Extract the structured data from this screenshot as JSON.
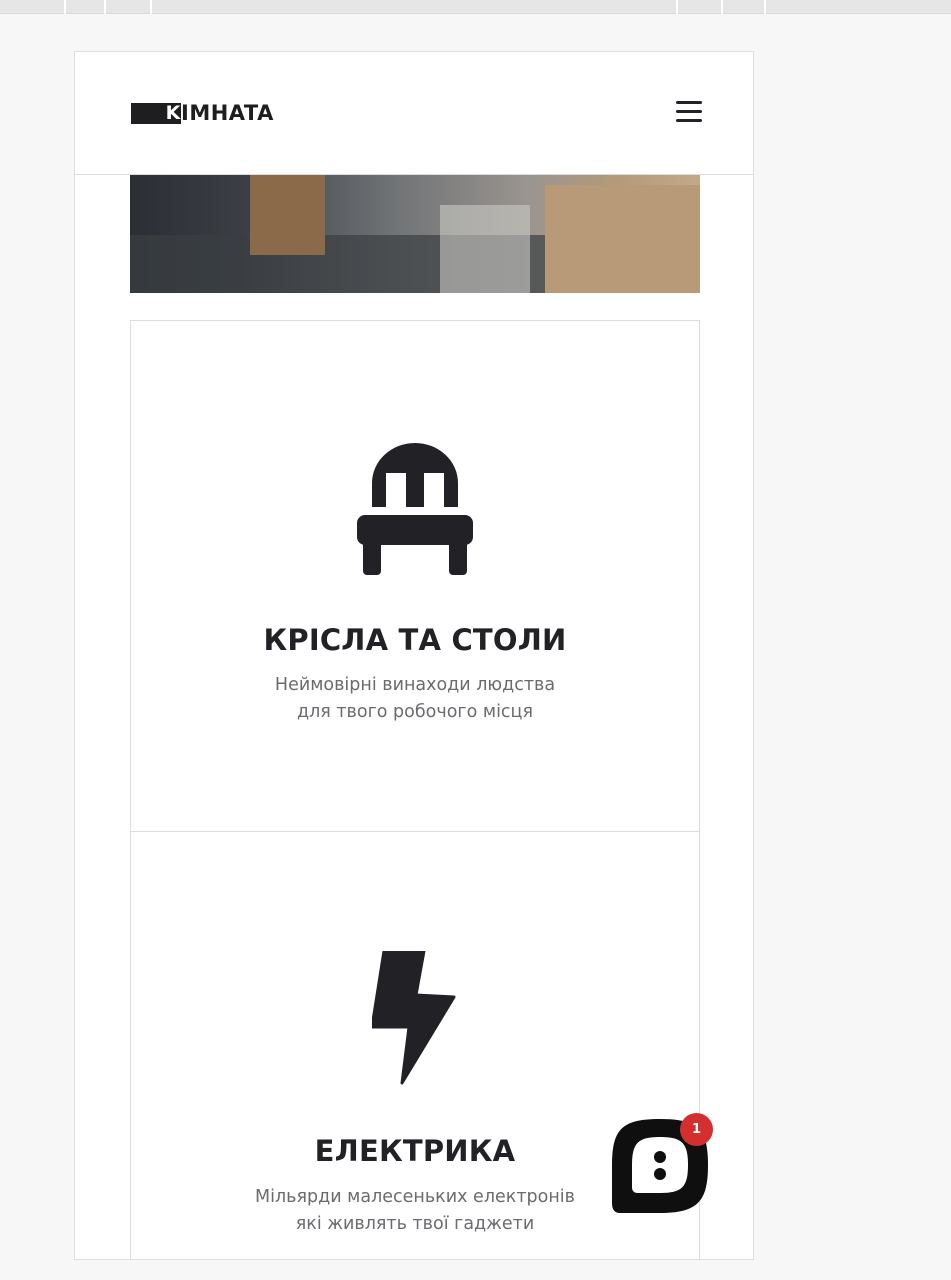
{
  "header": {
    "logo_mark": "K",
    "logo_text": "IMHATA"
  },
  "hero": {
    "image_desc": "office-photo"
  },
  "categories": [
    {
      "icon": "chair-icon",
      "title": "КРІСЛА ТА СТОЛИ",
      "desc_line1": "Неймовірні винаходи людства",
      "desc_line2": "для твого робочого місця"
    },
    {
      "icon": "lightning-icon",
      "title": "ЕЛЕКТРИКА",
      "desc_line1": "Мільярди малесеньких електронів",
      "desc_line2": "які живлять твої гаджети"
    }
  ],
  "chat": {
    "badge_count": "1"
  },
  "colors": {
    "text_dark": "#222226",
    "text_muted": "#6b6b6f",
    "badge": "#d32f2f"
  }
}
